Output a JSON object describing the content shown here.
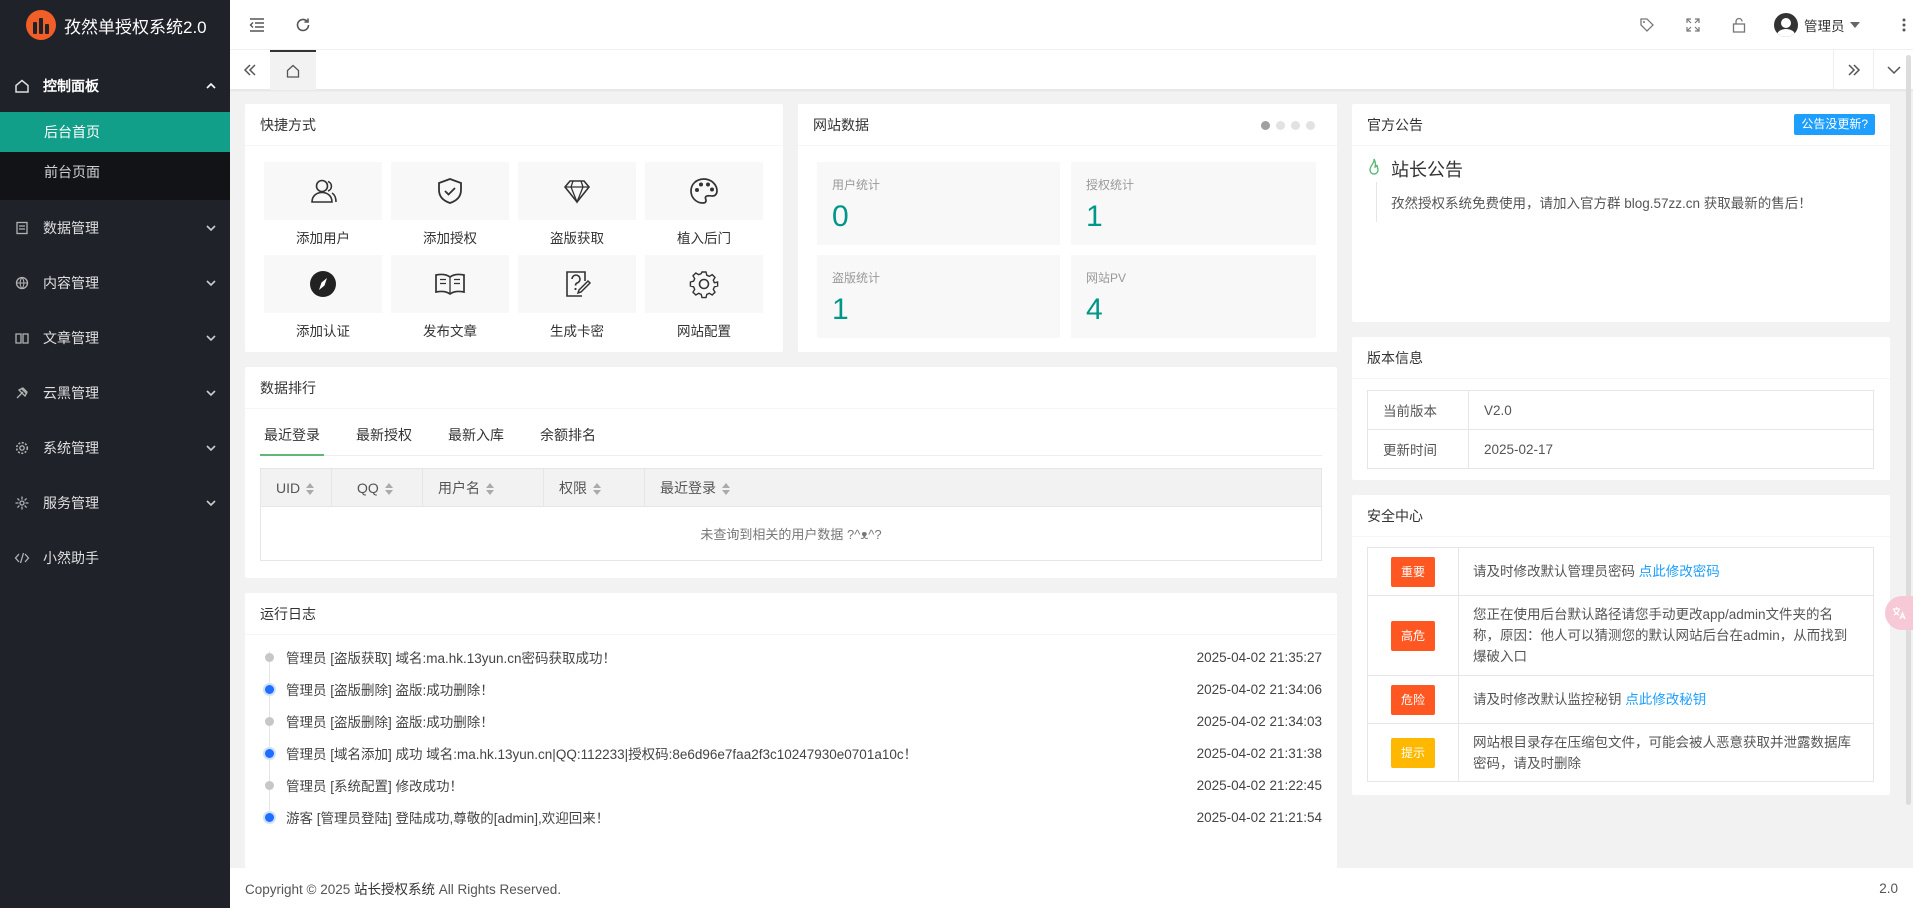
{
  "app": {
    "title": "孜然单授权系统2.0"
  },
  "sidebar": {
    "groups": [
      {
        "label": "控制面板",
        "icon": "home-icon",
        "open": true,
        "children": [
          {
            "label": "后台首页",
            "active": true
          },
          {
            "label": "前台页面",
            "active": false
          }
        ]
      },
      {
        "label": "数据管理",
        "icon": "database-icon"
      },
      {
        "label": "内容管理",
        "icon": "globe-icon"
      },
      {
        "label": "文章管理",
        "icon": "book-icon"
      },
      {
        "label": "云黑管理",
        "icon": "gavel-icon"
      },
      {
        "label": "系统管理",
        "icon": "gear-icon"
      },
      {
        "label": "服务管理",
        "icon": "cog-icon"
      },
      {
        "label": "小然助手",
        "icon": "code-icon"
      }
    ]
  },
  "header": {
    "user": "管理员"
  },
  "quick": {
    "title": "快捷方式",
    "items": [
      {
        "label": "添加用户",
        "icon": "users-icon"
      },
      {
        "label": "添加授权",
        "icon": "shield-check-icon"
      },
      {
        "label": "盗版获取",
        "icon": "diamond-icon"
      },
      {
        "label": "植入后门",
        "icon": "palette-icon"
      },
      {
        "label": "添加认证",
        "icon": "compass-icon"
      },
      {
        "label": "发布文章",
        "icon": "book-open-icon"
      },
      {
        "label": "生成卡密",
        "icon": "card-edit-icon"
      },
      {
        "label": "网站配置",
        "icon": "settings-icon"
      }
    ]
  },
  "site": {
    "title": "网站数据",
    "stats": [
      {
        "label": "用户统计",
        "value": "0"
      },
      {
        "label": "授权统计",
        "value": "1"
      },
      {
        "label": "盗版统计",
        "value": "1"
      },
      {
        "label": "网站PV",
        "value": "4"
      }
    ]
  },
  "ranking": {
    "title": "数据排行",
    "tabs": [
      "最近登录",
      "最新授权",
      "最新入库",
      "余额排名"
    ],
    "columns": [
      "UID",
      "QQ",
      "用户名",
      "权限",
      "最近登录"
    ],
    "empty": "未查询到相关的用户数据 ?^ᴥ^?"
  },
  "logs": {
    "title": "运行日志",
    "items": [
      {
        "msg": "管理员 [盗版获取] 域名:ma.hk.13yun.cn密码获取成功！",
        "time": "2025-04-02 21:35:27",
        "color": "#c2c2c2"
      },
      {
        "msg": "管理员 [盗版删除] 盗版:成功删除！",
        "time": "2025-04-02 21:34:06",
        "color": "#1e6fff"
      },
      {
        "msg": "管理员 [盗版删除] 盗版:成功删除！",
        "time": "2025-04-02 21:34:03",
        "color": "#c2c2c2"
      },
      {
        "msg": "管理员 [域名添加] 成功 域名:ma.hk.13yun.cn|QQ:112233|授权码:8e6d96e7faa2f3c10247930e0701a10c！",
        "time": "2025-04-02 21:31:38",
        "color": "#1e6fff"
      },
      {
        "msg": "管理员 [系统配置] 修改成功！",
        "time": "2025-04-02 21:22:45",
        "color": "#c2c2c2"
      },
      {
        "msg": "游客 [管理员登陆] 登陆成功,尊敬的[admin],欢迎回来！",
        "time": "2025-04-02 21:21:54",
        "color": "#1e6fff"
      }
    ]
  },
  "notice": {
    "title": "官方公告",
    "button": "公告没更新?",
    "heading": "站长公告",
    "body": "孜然授权系统免费使用，请加入官方群 blog.57zz.cn 获取最新的售后！"
  },
  "version": {
    "title": "版本信息",
    "rows": [
      {
        "k": "当前版本",
        "v": "V2.0"
      },
      {
        "k": "更新时间",
        "v": "2025-02-17"
      }
    ]
  },
  "security": {
    "title": "安全中心",
    "rows": [
      {
        "badge": "重要",
        "color": "#ff5722",
        "text": "请及时修改默认管理员密码 ",
        "link": "点此修改密码"
      },
      {
        "badge": "高危",
        "color": "#ff5722",
        "text": "您正在使用后台默认路径请您手动更改app/admin文件夹的名称，原因：他人可以猜测您的默认网站后台在admin，从而找到爆破入口",
        "link": ""
      },
      {
        "badge": "危险",
        "color": "#ff5722",
        "text": "请及时修改默认监控秘钥 ",
        "link": "点此修改秘钥"
      },
      {
        "badge": "提示",
        "color": "#ffb800",
        "text": "网站根目录存在压缩包文件，可能会被人恶意获取并泄露数据库密码，请及时删除",
        "link": ""
      }
    ]
  },
  "footer": {
    "copyright": "Copyright © 2025 ",
    "brand": "站长授权系统",
    "rights": " All Rights Reserved.",
    "version": "2.0"
  }
}
